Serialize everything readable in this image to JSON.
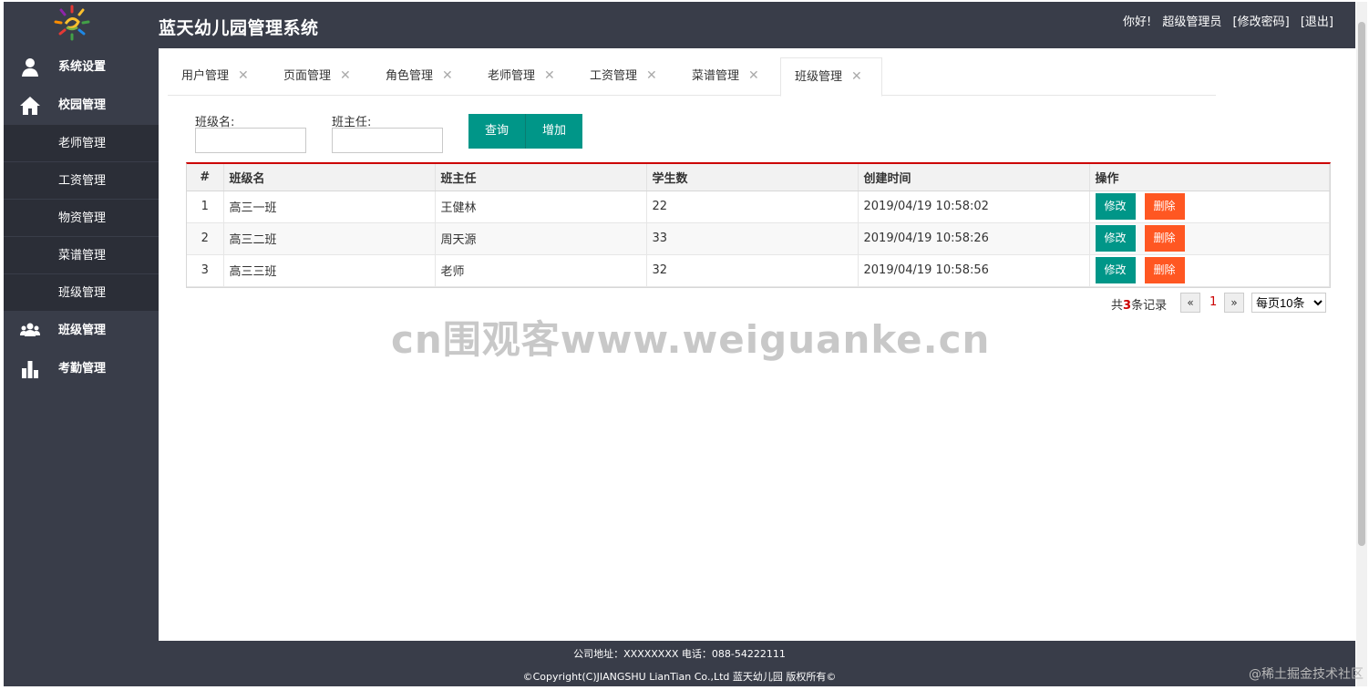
{
  "header": {
    "title": "蓝天幼儿园管理系统",
    "greeting": "你好!",
    "user": "超级管理员",
    "change_password": "[修改密码]",
    "logout": "[退出]"
  },
  "sidebar": {
    "items": [
      {
        "label": "系统设置",
        "icon": "user-icon"
      },
      {
        "label": "校园管理",
        "icon": "home-icon"
      },
      {
        "label": "班级管理",
        "icon": "group-icon"
      },
      {
        "label": "考勤管理",
        "icon": "bar-chart-icon"
      }
    ],
    "sub_items": [
      "老师管理",
      "工资管理",
      "物资管理",
      "菜谱管理",
      "班级管理"
    ]
  },
  "tabs": [
    {
      "label": "用户管理",
      "close": "✕"
    },
    {
      "label": "页面管理",
      "close": "✕"
    },
    {
      "label": "角色管理",
      "close": "✕"
    },
    {
      "label": "老师管理",
      "close": "✕"
    },
    {
      "label": "工资管理",
      "close": "✕"
    },
    {
      "label": "菜谱管理",
      "close": "✕"
    },
    {
      "label": "班级管理",
      "close": "✕"
    }
  ],
  "search": {
    "class_name_label": "班级名:",
    "class_name_value": "",
    "head_teacher_label": "班主任:",
    "head_teacher_value": "",
    "query_button": "查询",
    "add_button": "增加"
  },
  "table": {
    "headers": [
      "#",
      "班级名",
      "班主任",
      "学生数",
      "创建时间",
      "操作"
    ],
    "rows": [
      {
        "idx": "1",
        "name": "高三一班",
        "teacher": "王健林",
        "students": "22",
        "created": "2019/04/19 10:58:02",
        "edit": "修改",
        "delete": "删除"
      },
      {
        "idx": "2",
        "name": "高三二班",
        "teacher": "周天源",
        "students": "33",
        "created": "2019/04/19 10:58:26",
        "edit": "修改",
        "delete": "删除"
      },
      {
        "idx": "3",
        "name": "高三三班",
        "teacher": "老师",
        "students": "32",
        "created": "2019/04/19 10:58:56",
        "edit": "修改",
        "delete": "删除"
      }
    ]
  },
  "pager": {
    "total_prefix": "共",
    "total": "3",
    "total_suffix": "条记录",
    "prev": "«",
    "current": "1",
    "next": "»",
    "page_size": "每页10条"
  },
  "watermark": "cn围观客www.weiguanke.cn",
  "footer": {
    "address": "公司地址：XXXXXXXX 电话：088-54222111",
    "copyright": "©Copyright(C)JIANGSHU LianTian Co.,Ltd 蓝天幼儿园 版权所有©"
  },
  "corner_mark": "@稀土掘金技术社区",
  "colors": {
    "dark_bg": "#393d49",
    "submenu_bg": "#2b2e37",
    "primary": "#009688",
    "danger": "#ff5722",
    "table_accent": "#cc0000"
  }
}
